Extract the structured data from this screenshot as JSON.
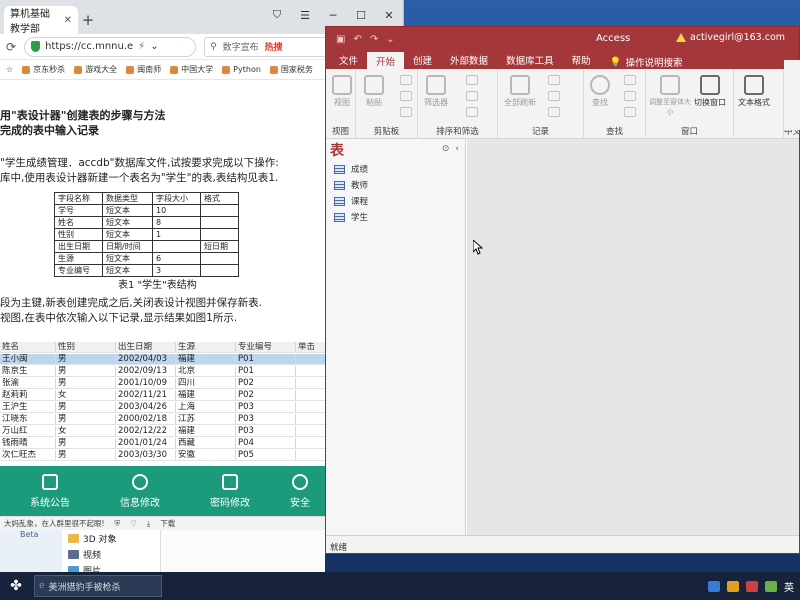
{
  "browser": {
    "tab_label": "算机基础教学部",
    "url": "https://cc.mnnu.e",
    "search_placeholder": "数字宣布",
    "hot_label": "热搜",
    "bookmarks": [
      "京东秒杀",
      "游戏大全",
      "闽南师",
      "中国大学",
      "Python",
      "国家税务"
    ],
    "status_text": "大妈乱象，在人群里很不起眼!",
    "status_items": [
      "下载"
    ]
  },
  "document": {
    "heading1": "用\"表设计器\"创建表的步骤与方法",
    "heading2": "完成的表中输入记录",
    "para1": "\"学生成绩管理．accdb\"数据库文件,试按要求完成以下操作:",
    "para2": "库中,使用表设计器新建一个表名为\"学生\"的表,表结构见表1.",
    "struct_header": [
      "字段名称",
      "数据类型",
      "字段大小",
      "格式"
    ],
    "struct_rows": [
      [
        "学号",
        "短文本",
        "10",
        ""
      ],
      [
        "姓名",
        "短文本",
        "8",
        ""
      ],
      [
        "性别",
        "短文本",
        "1",
        ""
      ],
      [
        "出生日期",
        "日期/时间",
        "",
        "短日期"
      ],
      [
        "生源",
        "短文本",
        "6",
        ""
      ],
      [
        "专业编号",
        "短文本",
        "3",
        ""
      ]
    ],
    "caption": "表1 \"学生\"表结构",
    "para3": "段为主键,新表创建完成之后,关闭表设计视图并保存新表.",
    "para4": "视图,在表中依次输入以下记录,显示结果如图1所示."
  },
  "datasheet": {
    "columns": [
      "姓名",
      "性别",
      "出生日期",
      "生源",
      "专业编号",
      "单击"
    ],
    "rows": [
      [
        "王小闽",
        "男",
        "2002/04/03",
        "福建",
        "P01"
      ],
      [
        "陈京生",
        "男",
        "2002/09/13",
        "北京",
        "P01"
      ],
      [
        "张渝",
        "男",
        "2001/10/09",
        "四川",
        "P02"
      ],
      [
        "赵莉莉",
        "女",
        "2002/11/21",
        "福建",
        "P02"
      ],
      [
        "王沪生",
        "男",
        "2003/04/26",
        "上海",
        "P03"
      ],
      [
        "江晓东",
        "男",
        "2000/02/18",
        "江苏",
        "P03"
      ],
      [
        "万山红",
        "女",
        "2002/12/22",
        "福建",
        "P03"
      ],
      [
        "钱雨晴",
        "男",
        "2001/01/24",
        "西藏",
        "P04"
      ],
      [
        "次仁旺杰",
        "男",
        "2003/03/30",
        "安徽",
        "P05"
      ]
    ]
  },
  "portal": {
    "items": [
      "系统公告",
      "信息修改",
      "密码修改",
      "安全"
    ]
  },
  "explorer": {
    "left_label": "Beta",
    "items": [
      "3D 对象",
      "视频",
      "图片"
    ]
  },
  "access": {
    "app_name": "Access",
    "user": "activegirl@163.com",
    "menu": [
      "文件",
      "开始",
      "创建",
      "外部数据",
      "数据库工具",
      "帮助"
    ],
    "tell_me": "操作说明搜索",
    "ribbon": {
      "groups": [
        "视图",
        "剪贴板",
        "排序和筛选",
        "记录",
        "查找",
        "窗口",
        "中文"
      ],
      "buttons": {
        "view": "视图",
        "paste": "粘贴",
        "filter": "筛选器",
        "refresh": "全部刷新",
        "find": "查找",
        "resize": "调整至窗体大小",
        "switch_window": "切换窗口",
        "text_format": "文本格式"
      }
    },
    "nav": {
      "title": "表",
      "tables": [
        "成绩",
        "教师",
        "课程",
        "学生"
      ]
    },
    "status": "就绪"
  },
  "taskbar": {
    "search_text": "美洲猎豹手被枪杀",
    "tray_lang": "英"
  },
  "colors": {
    "access_red": "#a4373a",
    "portal_green": "#1b9a7c",
    "selected_row": "#bcd6ee"
  }
}
